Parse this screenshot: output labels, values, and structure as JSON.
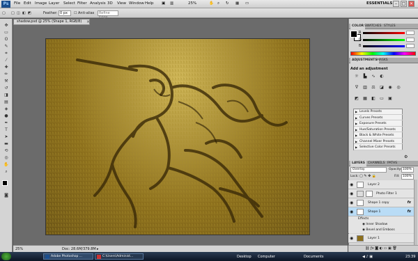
{
  "app": {
    "logo_text": "Ps",
    "menus": [
      "File",
      "Edit",
      "Image",
      "Layer",
      "Select",
      "Filter",
      "Analysis",
      "3D",
      "View",
      "Window",
      "Help"
    ],
    "zoom_level": "25%",
    "workspace": "ESSENTIALS",
    "window_controls": [
      "–",
      "□",
      "✕"
    ]
  },
  "options_bar": {
    "feather_label": "Feather:",
    "feather_value": "0 px",
    "antialias_label": "Anti-alias",
    "refine_edge_label": "Refine Edge..."
  },
  "document": {
    "tab_title": "shadow.psd @ 25% (Shape 1, RGB/8)",
    "tab_close": "×",
    "status_zoom": "25%",
    "status_doc": "Doc: 28.6M/379.8M"
  },
  "color_panel": {
    "tabs": [
      "COLOR",
      "SWATCHES",
      "STYLES"
    ],
    "channels": [
      {
        "label": "R",
        "value": ""
      },
      {
        "label": "G",
        "value": ""
      },
      {
        "label": "B",
        "value": ""
      }
    ]
  },
  "adjustments_panel": {
    "tabs": [
      "ADJUSTMENTS",
      "MASKS"
    ],
    "title": "Add an adjustment",
    "presets": [
      "Levels Presets",
      "Curves Presets",
      "Exposure Presets",
      "Hue/Saturation Presets",
      "Black & White Presets",
      "Channel Mixer Presets",
      "Selective Color Presets"
    ]
  },
  "layers_panel": {
    "tabs": [
      "LAYERS",
      "CHANNELS",
      "PATHS"
    ],
    "blend_mode": "Overlay",
    "opacity_label": "Opacity:",
    "opacity_value": "100%",
    "lock_label": "Lock:",
    "fill_label": "Fill:",
    "fill_value": "100%",
    "layers": [
      {
        "name": "Layer 2",
        "fx": ""
      },
      {
        "name": "Photo Filter 1",
        "fx": ""
      },
      {
        "name": "Shape 1 copy",
        "fx": "fx"
      },
      {
        "name": "Shape 1",
        "fx": "fx"
      },
      {
        "name": "Layer 1",
        "fx": ""
      }
    ],
    "effects_label": "Effects",
    "effects": [
      "Inner Shadow",
      "Bevel and Emboss"
    ]
  },
  "taskbar": {
    "buttons": [
      {
        "label": "Adobe Photoshop ..."
      },
      {
        "label": "C:\\Users\\Administ..."
      }
    ],
    "tray_items": [
      "Desktop",
      "Computer",
      "Documents"
    ],
    "clock": "23:39"
  },
  "colors": {
    "selection": "#b9dcf6",
    "canvas_grass": "#8c6f1c"
  }
}
